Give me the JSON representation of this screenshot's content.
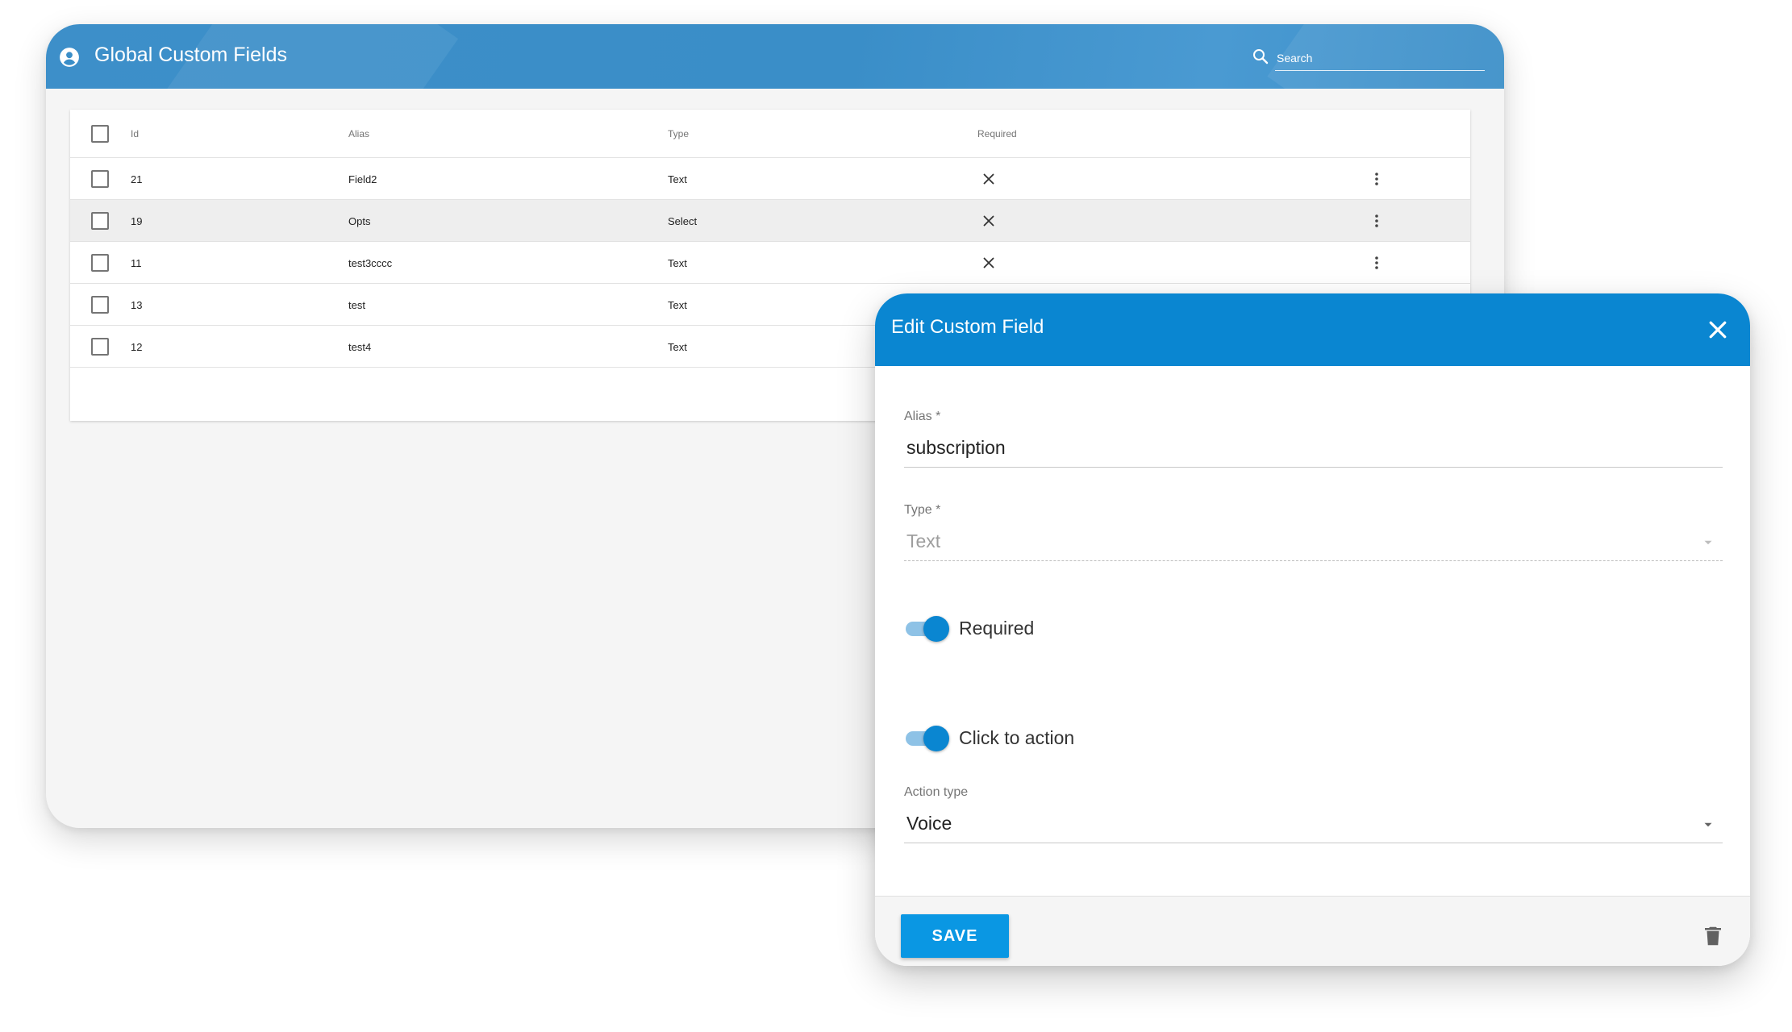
{
  "app": {
    "title": "Global Custom Fields",
    "search_placeholder": "Search",
    "header_color": "#3a8ec8"
  },
  "table": {
    "columns": [
      "Id",
      "Alias",
      "Type",
      "Required"
    ],
    "rows": [
      {
        "id": "21",
        "alias": "Field2",
        "type": "Text",
        "required": false
      },
      {
        "id": "19",
        "alias": "Opts",
        "type": "Select",
        "required": false
      },
      {
        "id": "11",
        "alias": "test3cccc",
        "type": "Text",
        "required": false
      },
      {
        "id": "13",
        "alias": "test",
        "type": "Text"
      },
      {
        "id": "12",
        "alias": "test4",
        "type": "Text"
      }
    ],
    "highlighted_row_id": "19"
  },
  "dialog": {
    "title": "Edit Custom Field",
    "header_color": "#0a86d1",
    "alias_label": "Alias *",
    "alias_value": "subscription",
    "type_label": "Type *",
    "type_value": "Text",
    "required_label": "Required",
    "required_on": true,
    "click_to_action_label": "Click to action",
    "click_to_action_on": true,
    "action_type_label": "Action type",
    "action_type_value": "Voice",
    "save_label": "SAVE",
    "save_color": "#0a97e3"
  },
  "icons": {
    "account": "account-circle-icon",
    "search": "search-icon",
    "close": "close-icon",
    "not_required": "x-icon",
    "row_menu": "more-vert-icon",
    "dropdown": "caret-down-icon",
    "delete": "trash-icon"
  }
}
